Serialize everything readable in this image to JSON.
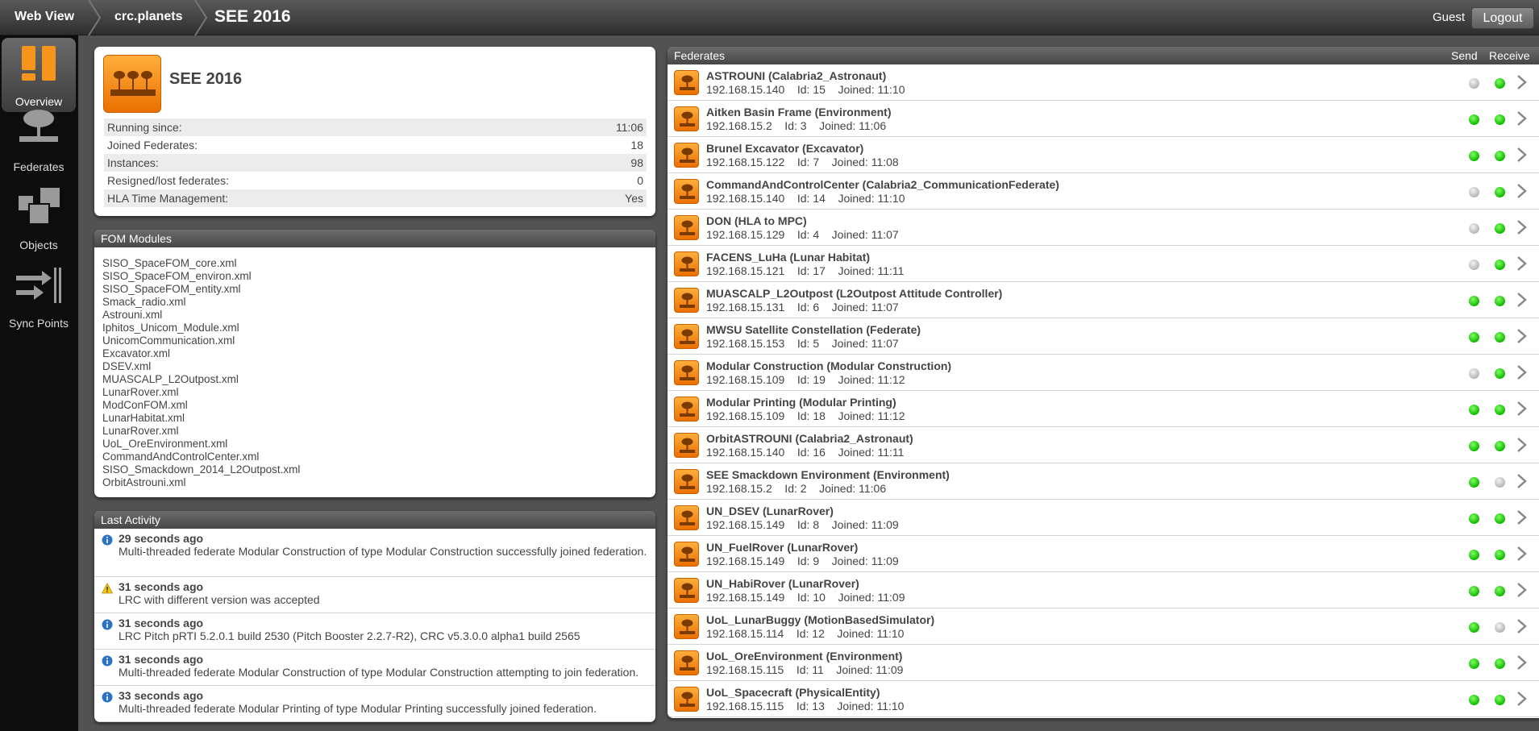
{
  "topbar": {
    "crumbs": [
      "Web View",
      "crc.planets",
      "SEE 2016"
    ],
    "user": "Guest",
    "logout_label": "Logout"
  },
  "nav": {
    "items": [
      {
        "label": "Overview",
        "icon": "overview-icon",
        "active": true
      },
      {
        "label": "Federates",
        "icon": "federates-icon"
      },
      {
        "label": "Objects",
        "icon": "objects-icon"
      },
      {
        "label": "Sync Points",
        "icon": "sync-points-icon"
      }
    ]
  },
  "summary": {
    "title": "SEE 2016",
    "rows": [
      {
        "label": "Running since:",
        "value": "11:06"
      },
      {
        "label": "Joined Federates:",
        "value": "18"
      },
      {
        "label": "Instances:",
        "value": "98"
      },
      {
        "label": "Resigned/lost federates:",
        "value": "0"
      },
      {
        "label": "HLA Time Management:",
        "value": "Yes"
      }
    ]
  },
  "fom": {
    "title": "FOM Modules",
    "modules": [
      "SISO_SpaceFOM_core.xml",
      "SISO_SpaceFOM_environ.xml",
      "SISO_SpaceFOM_entity.xml",
      "Smack_radio.xml",
      "Astrouni.xml",
      "Iphitos_Unicom_Module.xml",
      "UnicomCommunication.xml",
      "Excavator.xml",
      "DSEV.xml",
      "MUASCALP_L2Outpost.xml",
      "LunarRover.xml",
      "ModConFOM.xml",
      "LunarHabitat.xml",
      "LunarRover.xml",
      "UoL_OreEnvironment.xml",
      "CommandAndControlCenter.xml",
      "SISO_Smackdown_2014_L2Outpost.xml",
      "OrbitAstrouni.xml"
    ]
  },
  "activity": {
    "title": "Last Activity",
    "items": [
      {
        "type": "info",
        "time": "29 seconds ago",
        "text": "Multi-threaded federate Modular Construction of type Modular Construction successfully joined federation."
      },
      {
        "type": "warning",
        "time": "31 seconds ago",
        "text": "LRC with different version was accepted"
      },
      {
        "type": "info",
        "time": "31 seconds ago",
        "text": "LRC Pitch pRTI 5.2.0.1 build 2530 (Pitch Booster 2.2.7-R2), CRC v5.3.0.0 alpha1 build 2565"
      },
      {
        "type": "info",
        "time": "31 seconds ago",
        "text": "Multi-threaded federate Modular Construction of type Modular Construction attempting to join federation."
      },
      {
        "type": "info",
        "time": "33 seconds ago",
        "text": "Multi-threaded federate Modular Printing of type Modular Printing successfully joined federation."
      }
    ]
  },
  "federates": {
    "title": "Federates",
    "send_label": "Send",
    "receive_label": "Receive",
    "colors": {
      "on": "#22c400",
      "off": "#c0c0c0",
      "accent": "#f08a10"
    },
    "items": [
      {
        "name": "ASTROUNI (Calabria2_Astronaut)",
        "info": "192.168.15.140    Id: 15    Joined: 11:10",
        "send": false,
        "receive": true
      },
      {
        "name": "Aitken Basin Frame (Environment)",
        "info": "192.168.15.2    Id: 3    Joined: 11:06",
        "send": true,
        "receive": true
      },
      {
        "name": "Brunel Excavator (Excavator)",
        "info": "192.168.15.122    Id: 7    Joined: 11:08",
        "send": true,
        "receive": true
      },
      {
        "name": "CommandAndControlCenter (Calabria2_CommunicationFederate)",
        "info": "192.168.15.140    Id: 14    Joined: 11:10",
        "send": false,
        "receive": true
      },
      {
        "name": "DON (HLA to MPC)",
        "info": "192.168.15.129    Id: 4    Joined: 11:07",
        "send": false,
        "receive": true
      },
      {
        "name": "FACENS_LuHa (Lunar Habitat)",
        "info": "192.168.15.121    Id: 17    Joined: 11:11",
        "send": false,
        "receive": true
      },
      {
        "name": "MUASCALP_L2Outpost (L2Outpost Attitude Controller)",
        "info": "192.168.15.131    Id: 6    Joined: 11:07",
        "send": true,
        "receive": true
      },
      {
        "name": "MWSU Satellite Constellation (Federate)",
        "info": "192.168.15.153    Id: 5    Joined: 11:07",
        "send": true,
        "receive": true
      },
      {
        "name": "Modular Construction (Modular Construction)",
        "info": "192.168.15.109    Id: 19    Joined: 11:12",
        "send": false,
        "receive": true
      },
      {
        "name": "Modular Printing (Modular Printing)",
        "info": "192.168.15.109    Id: 18    Joined: 11:12",
        "send": true,
        "receive": true
      },
      {
        "name": "OrbitASTROUNI (Calabria2_Astronaut)",
        "info": "192.168.15.140    Id: 16    Joined: 11:11",
        "send": true,
        "receive": true
      },
      {
        "name": "SEE Smackdown Environment (Environment)",
        "info": "192.168.15.2    Id: 2    Joined: 11:06",
        "send": true,
        "receive": false
      },
      {
        "name": "UN_DSEV (LunarRover)",
        "info": "192.168.15.149    Id: 8    Joined: 11:09",
        "send": true,
        "receive": true
      },
      {
        "name": "UN_FuelRover (LunarRover)",
        "info": "192.168.15.149    Id: 9    Joined: 11:09",
        "send": true,
        "receive": true
      },
      {
        "name": "UN_HabiRover (LunarRover)",
        "info": "192.168.15.149    Id: 10    Joined: 11:09",
        "send": true,
        "receive": true
      },
      {
        "name": "UoL_LunarBuggy (MotionBasedSimulator)",
        "info": "192.168.15.114    Id: 12    Joined: 11:10",
        "send": true,
        "receive": false
      },
      {
        "name": "UoL_OreEnvironment (Environment)",
        "info": "192.168.15.115    Id: 11    Joined: 11:09",
        "send": true,
        "receive": true
      },
      {
        "name": "UoL_Spacecraft (PhysicalEntity)",
        "info": "192.168.15.115    Id: 13    Joined: 11:10",
        "send": true,
        "receive": true
      }
    ]
  }
}
